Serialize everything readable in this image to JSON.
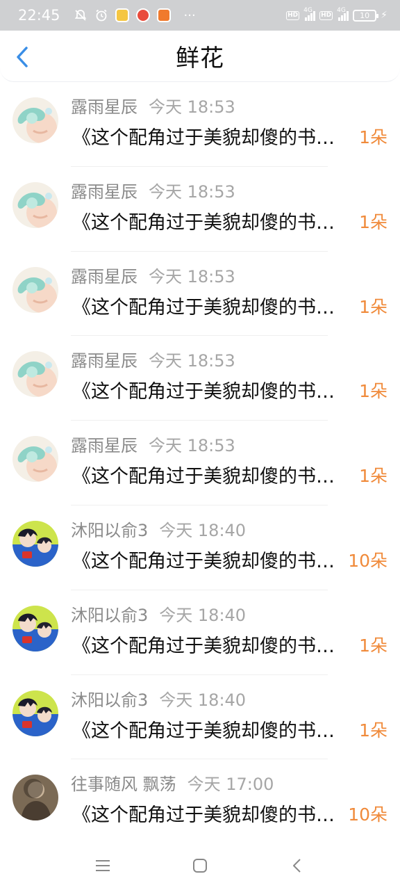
{
  "status_bar": {
    "time": "22:45",
    "battery_level": "10",
    "network_1": "4G",
    "network_2": "4G",
    "hd_1": "HD",
    "hd_2": "HD",
    "more": "···"
  },
  "header": {
    "title": "鲜花"
  },
  "list": [
    {
      "name": "露雨星辰",
      "time": "今天 18:53",
      "title": "《这个配角过于美貌却傻的书名很长很长",
      "amount": "1朵",
      "avatar": "mint-anime-avatar"
    },
    {
      "name": "露雨星辰",
      "time": "今天 18:53",
      "title": "《这个配角过于美貌却傻的书名很长很长",
      "amount": "1朵",
      "avatar": "mint-anime-avatar"
    },
    {
      "name": "露雨星辰",
      "time": "今天 18:53",
      "title": "《这个配角过于美貌却傻的书名很长很长",
      "amount": "1朵",
      "avatar": "mint-anime-avatar"
    },
    {
      "name": "露雨星辰",
      "time": "今天 18:53",
      "title": "《这个配角过于美貌却傻的书名很长很长",
      "amount": "1朵",
      "avatar": "mint-anime-avatar"
    },
    {
      "name": "露雨星辰",
      "time": "今天 18:53",
      "title": "《这个配角过于美貌却傻的书名很长很长",
      "amount": "1朵",
      "avatar": "mint-anime-avatar"
    },
    {
      "name": "沐阳以俞3",
      "time": "今天 18:40",
      "title": "《这个配角过于美貌却傻的书名很长很长",
      "amount": "10朵",
      "avatar": "blue-anime-avatar"
    },
    {
      "name": "沐阳以俞3",
      "time": "今天 18:40",
      "title": "《这个配角过于美貌却傻的书名很长很长",
      "amount": "1朵",
      "avatar": "blue-anime-avatar"
    },
    {
      "name": "沐阳以俞3",
      "time": "今天 18:40",
      "title": "《这个配角过于美貌却傻的书名很长很长",
      "amount": "1朵",
      "avatar": "blue-anime-avatar"
    },
    {
      "name": "往事随风 飘荡",
      "time": "今天 17:00",
      "title": "《这个配角过于美貌却傻的书名很长很长",
      "amount": "10朵",
      "avatar": "photo-avatar"
    }
  ],
  "colors": {
    "amount": "#f08a3a",
    "back_arrow": "#3a8ee6",
    "status_bar_bg": "#cfd0d2"
  },
  "icons": {
    "back": "chevron-left-icon",
    "nav_menu": "menu-icon",
    "nav_home": "home-square-icon",
    "nav_back": "back-chevron-icon"
  }
}
